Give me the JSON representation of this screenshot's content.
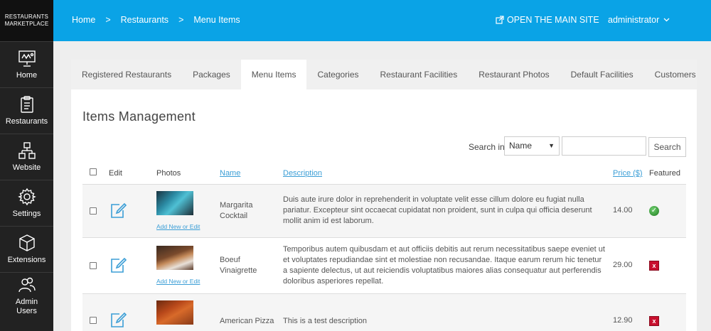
{
  "brand": {
    "line1": "RESTAURANTS",
    "line2": "MARKETPLACE"
  },
  "sidebar": {
    "items": [
      {
        "label": "Home",
        "icon": "presentation-icon"
      },
      {
        "label": "Restaurants",
        "icon": "clipboard-icon"
      },
      {
        "label": "Website",
        "icon": "sitemap-icon"
      },
      {
        "label": "Settings",
        "icon": "gear-icon"
      },
      {
        "label": "Extensions",
        "icon": "box-icon"
      },
      {
        "label_line1": "Admin",
        "label_line2": "Users",
        "icon": "users-icon"
      }
    ]
  },
  "topbar": {
    "breadcrumb": [
      "Home",
      "Restaurants",
      "Menu Items"
    ],
    "separator": ">",
    "open_site": "OPEN THE MAIN SITE",
    "user": "administrator",
    "color": "#0aa3e6"
  },
  "tabs": [
    "Registered Restaurants",
    "Packages",
    "Menu Items",
    "Categories",
    "Restaurant Facilities",
    "Restaurant Photos",
    "Default Facilities",
    "Customers"
  ],
  "active_tab": "Menu Items",
  "page_title": "Items Management",
  "search": {
    "label": "Search in:",
    "field_selected": "Name",
    "query": "",
    "button": "Search"
  },
  "table": {
    "headers": {
      "edit": "Edit",
      "photos": "Photos",
      "name": "Name",
      "description": "Description",
      "price": "Price ($)",
      "featured": "Featured"
    },
    "add_photo_link": "Add New or Edit",
    "rows": [
      {
        "name": "Margarita Cocktail",
        "description": "Duis aute irure dolor in reprehenderit in voluptate velit esse cillum dolore eu fugiat nulla pariatur. Excepteur sint occaecat cupidatat non proident, sunt in culpa qui officia deserunt mollit anim id est laborum.",
        "price": "14.00",
        "featured": true
      },
      {
        "name": "Boeuf Vinaigrette",
        "description": "Temporibus autem quibusdam et aut officiis debitis aut rerum necessitatibus saepe eveniet ut et voluptates repudiandae sint et molestiae non recusandae. Itaque earum rerum hic tenetur a sapiente delectus, ut aut reiciendis voluptatibus maiores alias consequatur aut perferendis doloribus asperiores repellat.",
        "price": "29.00",
        "featured": false
      },
      {
        "name": "American Pizza",
        "description": "This is a test description",
        "price": "12.90",
        "featured": false
      }
    ]
  }
}
